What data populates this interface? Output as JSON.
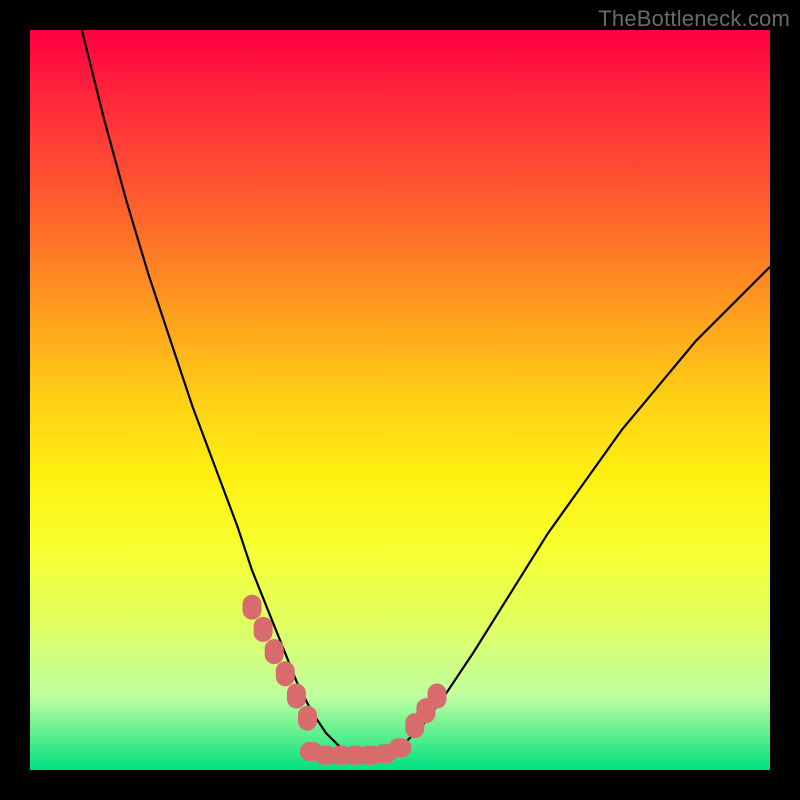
{
  "attribution": "TheBottleneck.com",
  "colors": {
    "frame": "#000000",
    "curve": "#000000",
    "marker": "#d86c6c",
    "gradient_top": "#ff0040",
    "gradient_bottom": "#00e080"
  },
  "chart_data": {
    "type": "line",
    "title": "",
    "xlabel": "",
    "ylabel": "",
    "xlim": [
      0,
      100
    ],
    "ylim": [
      0,
      100
    ],
    "grid": false,
    "legend": false,
    "series": [
      {
        "name": "bottleneck-curve",
        "x": [
          7,
          10,
          13,
          16,
          19,
          22,
          25,
          28,
          30,
          32,
          34,
          36,
          38,
          40,
          42,
          44,
          47,
          50,
          53,
          56,
          60,
          65,
          70,
          75,
          80,
          85,
          90,
          95,
          100
        ],
        "y": [
          100,
          88,
          77,
          67,
          58,
          49,
          41,
          33,
          27,
          22,
          17,
          12,
          8,
          5,
          3,
          2,
          2,
          3,
          6,
          10,
          16,
          24,
          32,
          39,
          46,
          52,
          58,
          63,
          68
        ]
      }
    ],
    "annotations": [
      {
        "name": "left-marker-cluster",
        "x": [
          30,
          31.5,
          33,
          34.5,
          36,
          37.5
        ],
        "y": [
          22,
          19,
          16,
          13,
          10,
          7
        ]
      },
      {
        "name": "right-marker-cluster",
        "x": [
          52,
          53.5,
          55
        ],
        "y": [
          6,
          8,
          10
        ]
      },
      {
        "name": "bottom-marker-bar",
        "x": [
          38,
          40,
          42,
          44,
          46,
          48,
          50
        ],
        "y": [
          2.5,
          2,
          2,
          2,
          2,
          2.2,
          3
        ]
      }
    ]
  }
}
